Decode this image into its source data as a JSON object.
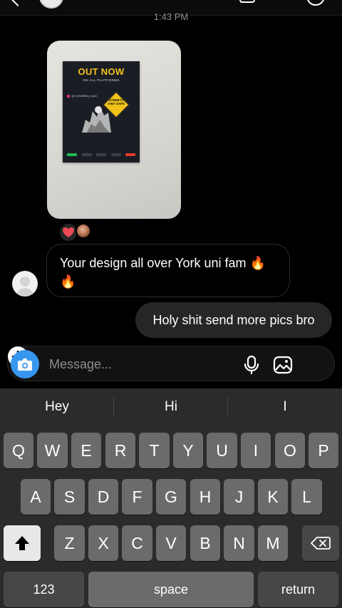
{
  "thread": {
    "timestamp": "1:43 PM"
  },
  "image_message": {
    "poster_title": "OUT NOW",
    "poster_subtitle": "ON ALL PLATFORMS",
    "poster_handle": "@YOSHIBRA_KAZI",
    "poster_sign_text": "STREETS AINT SAFE"
  },
  "reactions": {
    "emoji": "heart"
  },
  "messages": [
    {
      "direction": "incoming",
      "text": "Your design all over York uni fam 🔥 🔥"
    },
    {
      "direction": "outgoing",
      "text": "Holy shit send more pics bro"
    }
  ],
  "composer": {
    "placeholder": "Message...",
    "accent_color": "#3797f0"
  },
  "keyboard": {
    "suggestions": [
      "Hey",
      "Hi",
      "I"
    ],
    "row1": [
      "Q",
      "W",
      "E",
      "R",
      "T",
      "Y",
      "U",
      "I",
      "O",
      "P"
    ],
    "row2": [
      "A",
      "S",
      "D",
      "F",
      "G",
      "H",
      "J",
      "K",
      "L"
    ],
    "row3": [
      "Z",
      "X",
      "C",
      "V",
      "B",
      "N",
      "M"
    ],
    "numbers_label": "123",
    "space_label": "space",
    "return_label": "return"
  }
}
